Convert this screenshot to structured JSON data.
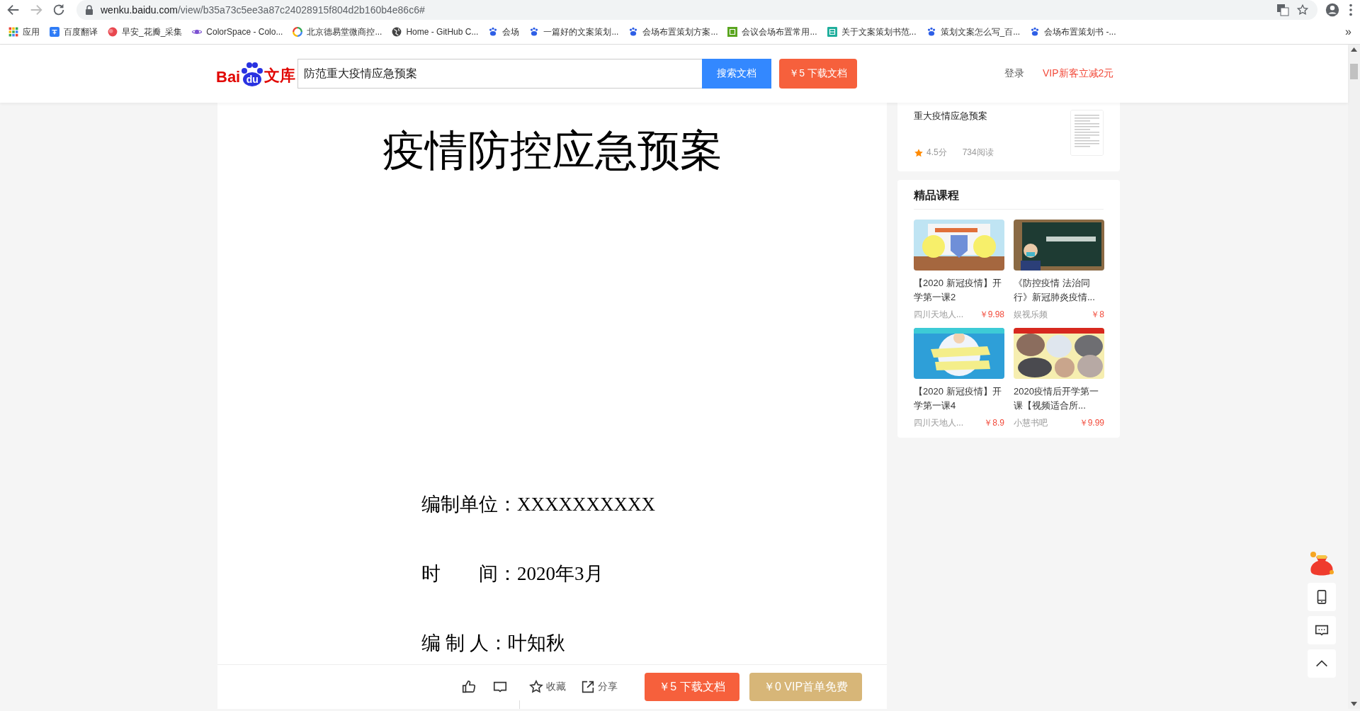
{
  "browser": {
    "url_host": "wenku.baidu.com",
    "url_path": "/view/b35a73c5ee3a87c24028915f804d2b160b4e86c6#",
    "bookmarks": [
      {
        "label": "应用",
        "kind": "apps"
      },
      {
        "label": "百度翻译",
        "kind": "translate"
      },
      {
        "label": "早安_花瓣_采集",
        "kind": "petal"
      },
      {
        "label": "ColorSpace - Colo...",
        "kind": "planet"
      },
      {
        "label": "北京德易堂微商控...",
        "kind": "ring"
      },
      {
        "label": "Home - GitHub C...",
        "kind": "globe"
      },
      {
        "label": "会场",
        "kind": "paw"
      },
      {
        "label": "一篇好的文案策划...",
        "kind": "paw"
      },
      {
        "label": "会场布置策划方案...",
        "kind": "paw"
      },
      {
        "label": "会议会场布置常用...",
        "kind": "square"
      },
      {
        "label": "关于文案策划书范...",
        "kind": "framed"
      },
      {
        "label": "策划文案怎么写_百...",
        "kind": "paw"
      },
      {
        "label": "会场布置策划书 -...",
        "kind": "paw"
      }
    ],
    "overflow": "»"
  },
  "header": {
    "logo": {
      "left": "Bai",
      "paw": "du",
      "right": "文库"
    },
    "search": {
      "value": "防范重大疫情应急预案"
    },
    "search_button": "搜索文档",
    "download_button": "￥5 下载文档",
    "login": "登录",
    "promo": "VIP新客立减2元"
  },
  "document": {
    "title": "疫情防控应急预案",
    "lines": [
      "编制单位：XXXXXXXXXX",
      "时　　间：2020年3月",
      "编 制 人：叶知秋"
    ]
  },
  "bottom_bar": {
    "actions": [
      {
        "label": "收藏",
        "kind": "star"
      },
      {
        "label": "分享",
        "kind": "share"
      }
    ],
    "buttons": [
      {
        "label": "￥5 下载文档",
        "kind": "download"
      },
      {
        "label": "￥0 VIP首单免费",
        "kind": "vip"
      }
    ]
  },
  "sidebar": {
    "related": {
      "title": "重大疫情应急预案",
      "score": "4.5分",
      "reads": "734阅读"
    },
    "courses": {
      "title": "精品课程",
      "items": [
        {
          "title": "【2020 新冠疫情】开学第一课2",
          "author": "四川天地人...",
          "price": "￥9.98"
        },
        {
          "title": "《防控疫情 法治同行》新冠肺炎疫情...",
          "author": "娱视乐频",
          "price": "￥8"
        },
        {
          "title": "【2020 新冠疫情】开学第一课4",
          "author": "四川天地人...",
          "price": "￥8.9"
        },
        {
          "title": "2020疫情后开学第一课【视频适合所...",
          "author": "小慧书吧",
          "price": "￥9.99"
        }
      ]
    }
  }
}
